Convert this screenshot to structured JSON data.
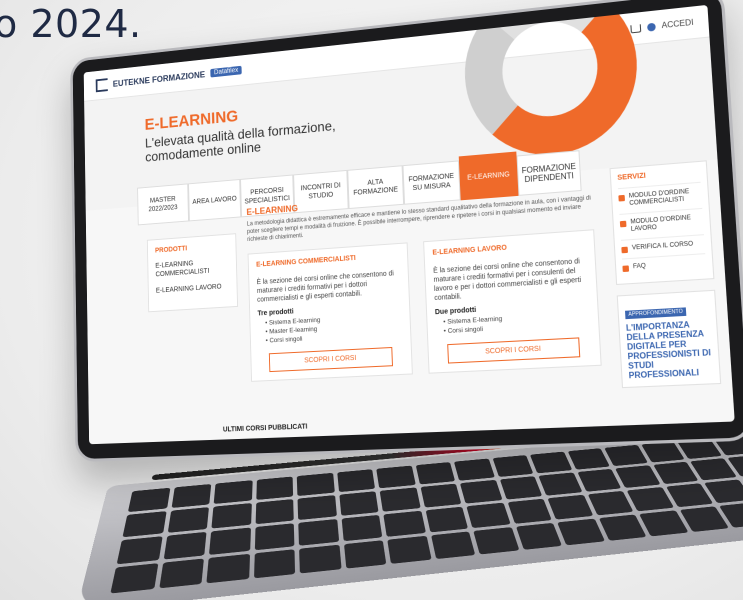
{
  "headline": "o 2024.",
  "header": {
    "brand_name": "EUTEKNE FORMAZIONE",
    "brand_partner": "Dataﬁlex",
    "account_label": "ACCEDI"
  },
  "hero": {
    "title": "E-LEARNING",
    "subtitle": "L'elevata qualità della formazione, comodamente online"
  },
  "tabs": [
    {
      "label": "MASTER 2022/2023"
    },
    {
      "label": "AREA LAVORO"
    },
    {
      "label": "PERCORSI SPECIALISTICI"
    },
    {
      "label": "INCONTRI DI STUDIO"
    },
    {
      "label": "ALTA FORMAZIONE"
    },
    {
      "label": "FORMAZIONE SU MISURA"
    },
    {
      "label": "E-LEARNING"
    },
    {
      "label": "FORMAZIONE DIPENDENTI"
    }
  ],
  "sidebar": {
    "title": "PRODOTTI",
    "items": [
      {
        "label": "E-LEARNING COMMERCIALISTI"
      },
      {
        "label": "E-LEARNING LAVORO"
      }
    ]
  },
  "main": {
    "title": "E-LEARNING",
    "intro": "La metodologia didattica è estremamente efficace e mantiene lo stesso standard qualitativo della formazione in aula, con i vantaggi di poter scegliere tempi e modalità di fruizione. È possibile interrompere, riprendere e ripetere i corsi in qualsiasi momento ed inviare richieste di chiarimenti.",
    "cards": [
      {
        "title": "E-LEARNING COMMERCIALISTI",
        "text": "È la sezione dei corsi online che consentono di maturare i crediti formativi per i dottori commercialisti e gli esperti contabili.",
        "products_label": "Tre prodotti",
        "products": [
          "Sistema E-learning",
          "Master E-learning",
          "Corsi singoli"
        ],
        "button": "SCOPRI I CORSI"
      },
      {
        "title": "E-LEARNING LAVORO",
        "text": "È la sezione dei corsi online che consentono di maturare i crediti formativi per i consulenti del lavoro e per i dottori commercialisti e gli esperti contabili.",
        "products_label": "Due prodotti",
        "products": [
          "Sistema E-learning",
          "Corsi singoli"
        ],
        "button": "SCOPRI I CORSI"
      }
    ]
  },
  "rightcol": {
    "title": "SERVIZI",
    "items": [
      {
        "label": "MODULO D'ORDINE COMMERCIALISTI"
      },
      {
        "label": "MODULO D'ORDINE LAVORO"
      },
      {
        "label": "VERIFICA IL CORSO"
      },
      {
        "label": "FAQ"
      }
    ],
    "news_tag": "APPROFONDIMENTO",
    "news_title": "L'IMPORTANZA DELLA PRESENZA DIGITALE PER PROFESSIONISTI DI STUDI PROFESSIONALI"
  },
  "bottom_label": "ULTIMI CORSI PUBBLICATI"
}
